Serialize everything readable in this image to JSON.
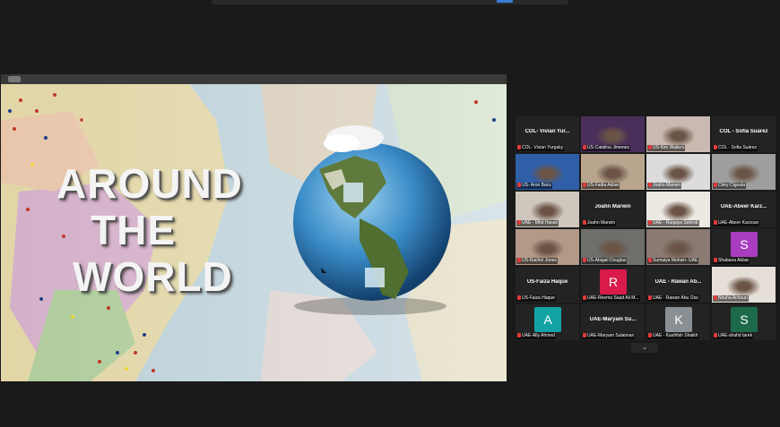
{
  "colors": {
    "background": "#1a1a1a",
    "tile_bg": "#232323",
    "active_speaker": "#b8d84a",
    "muted_icon": "#e23b3b"
  },
  "slide": {
    "title_lines": [
      "AROUND",
      "THE",
      "WORLD"
    ]
  },
  "gallery": {
    "tiles": [
      {
        "type": "name",
        "display": "COL- Vivian Yur...",
        "label": "COL- Vivian Yurgaky"
      },
      {
        "type": "video",
        "label": "US-Catalina Jimenez",
        "tone": "#4a2f5a"
      },
      {
        "type": "video",
        "label": "US-Kim Walters",
        "tone": "#c9b9b0"
      },
      {
        "type": "name",
        "display": "COL - Sofia Suárez",
        "label": "COL - Sofia Suárez"
      },
      {
        "type": "video",
        "label": "US- Aron Bacs",
        "tone": "#2f5fa8"
      },
      {
        "type": "video",
        "label": "US-Fadia Akbar",
        "tone": "#b9a58e"
      },
      {
        "type": "video",
        "label": "Joahn Marwin",
        "tone": "#dcdcdc"
      },
      {
        "type": "video",
        "label": "Clery Cigoula",
        "tone": "#9e9e9e"
      },
      {
        "type": "video",
        "label": "UAE - Mhd Hasan",
        "tone": "#cfc7bd"
      },
      {
        "type": "name",
        "display": "Joahn Marwin",
        "label": "Joahn Marwin"
      },
      {
        "type": "video",
        "label": "UAE - Ruqaiya Sahrob",
        "tone": "#ece8e2"
      },
      {
        "type": "name",
        "display": "UAE-Abeer Karz...",
        "label": "UAE-Abeer Karzoun"
      },
      {
        "type": "video",
        "label": "US-Rachel Jones",
        "tone": "#b39a88"
      },
      {
        "type": "video",
        "label": "US-Abigail Douglas",
        "tone": "#6e6e6a",
        "active": true
      },
      {
        "type": "video",
        "label": "Sumaiya Mohsin- UAE",
        "tone": "#8a7a72"
      },
      {
        "type": "avatar",
        "letter": "S",
        "avatar_color": "#a93dc0",
        "label": "Shabana Akbar"
      },
      {
        "type": "name",
        "display": "US-Faiza Haque",
        "label": "US-Faiza Haque"
      },
      {
        "type": "avatar",
        "letter": "R",
        "avatar_color": "#d81b4a",
        "label": "UAE-Reema Saad Ali M..."
      },
      {
        "type": "name",
        "display": "UAE - Rawan Ab...",
        "label": "UAE - Rawan Abu Oss"
      },
      {
        "type": "video",
        "label": "Nouha Achouri",
        "tone": "#e6dfd8"
      },
      {
        "type": "avatar",
        "letter": "A",
        "avatar_color": "#14a3a3",
        "label": "UAE-Ally Ahmed"
      },
      {
        "type": "name",
        "display": "UAE-Maryam Su...",
        "label": "UAE-Maryam Sulaiman"
      },
      {
        "type": "avatar",
        "letter": "K",
        "avatar_color": "#8a8f94",
        "label": "UAE - Kashfish Shaikh"
      },
      {
        "type": "avatar",
        "letter": "S",
        "avatar_color": "#1d6a4a",
        "label": "UAE-shahd tarek"
      }
    ],
    "pager_icon": "chevron-down-icon",
    "pager_glyph": "⌄"
  }
}
